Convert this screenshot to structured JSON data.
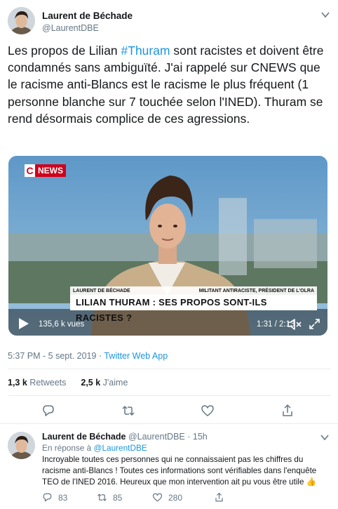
{
  "tweet": {
    "author_name": "Laurent de Béchade",
    "author_handle": "@LaurentDBE",
    "text_before": "Les propos de Lilian ",
    "hashtag": "#Thuram",
    "text_after": " sont racistes et doivent être condamnés sans ambiguïté. J'ai rappelé sur CNEWS que le racisme anti-Blancs est le racisme le plus fréquent (1 personne blanche sur 7 touchée selon l'INED). Thuram se rend désormais complice de ces agressions.",
    "timestamp": "5:37 PM - 5 sept. 2019",
    "separator": " · ",
    "source": "Twitter Web App",
    "retweets_count": "1,3 k",
    "retweets_label": "Retweets",
    "likes_count": "2,5 k",
    "likes_label": "J'aime"
  },
  "video": {
    "channel_logo_c": "C",
    "channel_logo_news": "NEWS",
    "lower_third_name": "LAURENT DE BÉCHADE",
    "lower_third_role": "MILITANT ANTIRACISTE, PRÉSIDENT DE L'OLRA",
    "lower_third_headline": "LILIAN THURAM : SES PROPOS SONT-ILS RACISTES ?",
    "views": "135,6 k vues",
    "time": "1:31 / 2:13"
  },
  "reply": {
    "author_name": "Laurent de Béchade",
    "author_handle": "@LaurentDBE",
    "age": "15h",
    "reply_to_prefix": "En réponse à ",
    "reply_to_handle": "@LaurentDBE",
    "text": "Incroyable toutes ces personnes qui ne connaissaient pas les chiffres du racisme anti-Blancs ! Toutes ces informations sont vérifiables dans l'enquête TEO de l'INED 2016. Heureux que mon intervention ait pu vous être utile 👍",
    "replies_count": "83",
    "retweets_count": "85",
    "likes_count": "280"
  },
  "colors": {
    "link": "#1b95e0",
    "secondary_text": "#657786",
    "divider": "#e6ecf0",
    "cnews_red": "#d0021b"
  },
  "icons": [
    "chevron-down-icon",
    "play-icon",
    "volume-icon",
    "fullscreen-icon",
    "reply-icon",
    "retweet-icon",
    "like-icon",
    "share-icon",
    "thumbs-up-emoji"
  ]
}
